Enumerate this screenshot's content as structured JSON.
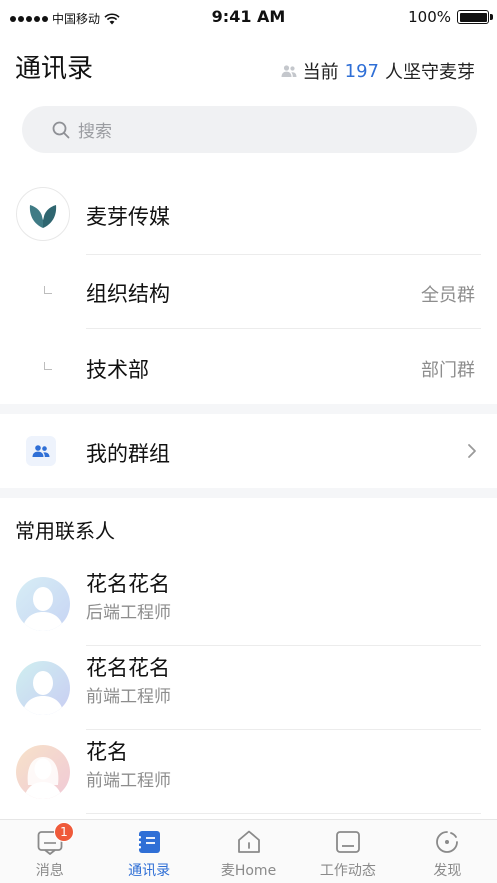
{
  "status_bar": {
    "carrier": "中国移动",
    "time": "9:41 AM",
    "battery": "100%"
  },
  "header": {
    "title": "通讯录",
    "stay_prefix": "当前",
    "stay_count": "197",
    "stay_suffix": "人坚守麦芽"
  },
  "search": {
    "placeholder": "搜索"
  },
  "organization": {
    "name": "麦芽传媒",
    "sub_items": [
      {
        "label": "组织结构",
        "tag": "全员群"
      },
      {
        "label": "技术部",
        "tag": "部门群"
      }
    ]
  },
  "my_groups": {
    "label": "我的群组"
  },
  "frequent_contacts": {
    "title": "常用联系人",
    "items": [
      {
        "name": "花名花名",
        "role": "后端工程师"
      },
      {
        "name": "花名花名",
        "role": "前端工程师"
      },
      {
        "name": "花名",
        "role": "前端工程师"
      }
    ]
  },
  "tab_bar": {
    "items": [
      {
        "label": "消息",
        "badge": "1",
        "icon": "message-icon"
      },
      {
        "label": "通讯录",
        "icon": "contacts-icon"
      },
      {
        "label": "麦Home",
        "icon": "home-icon"
      },
      {
        "label": "工作动态",
        "icon": "work-feed-icon"
      },
      {
        "label": "发现",
        "icon": "discover-icon"
      }
    ]
  },
  "colors": {
    "accent": "#2f6fd6",
    "badge": "#ef5a3a",
    "logo": "#3f7b85"
  }
}
